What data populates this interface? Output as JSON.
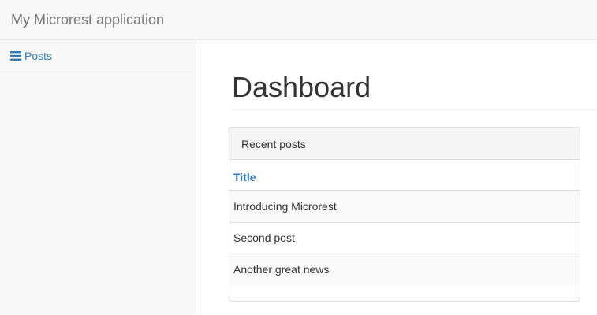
{
  "app": {
    "title": "My Microrest application"
  },
  "sidebar": {
    "items": [
      {
        "label": "Posts",
        "icon": "list-icon"
      }
    ]
  },
  "main": {
    "page_title": "Dashboard",
    "panel": {
      "heading": "Recent posts",
      "columns": [
        "Title"
      ],
      "rows": [
        {
          "title": "Introducing Microrest"
        },
        {
          "title": "Second post"
        },
        {
          "title": "Another great news"
        }
      ]
    }
  },
  "colors": {
    "link": "#337ab7",
    "navbar_bg": "#f8f8f8",
    "border": "#dddddd"
  }
}
